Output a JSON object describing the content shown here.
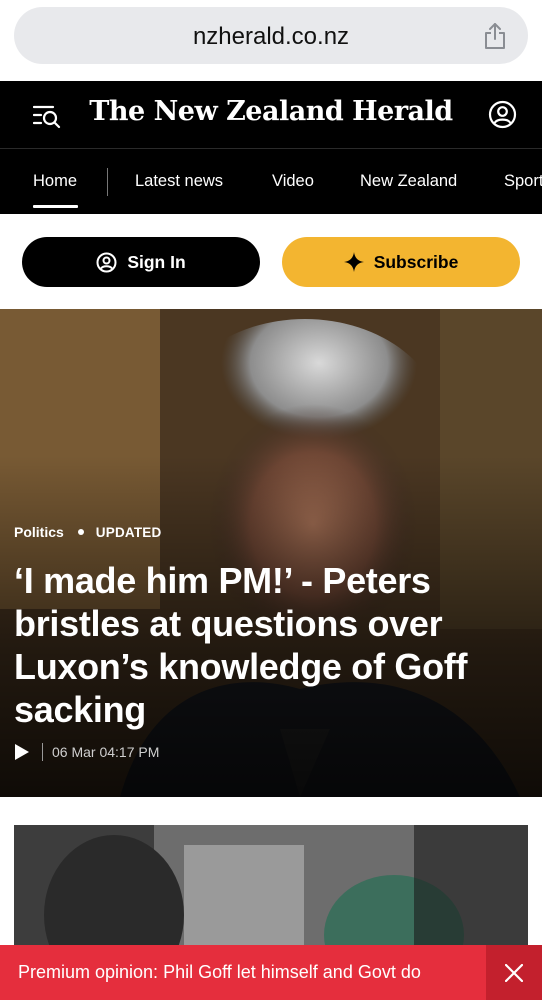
{
  "browser": {
    "url": "nzherald.co.nz",
    "share_icon": "share-icon"
  },
  "header": {
    "masthead": "The New Zealand Herald",
    "menu_icon": "menu-search-icon",
    "account_icon": "account-icon"
  },
  "nav": {
    "items": [
      "Home",
      "Latest news",
      "Video",
      "New Zealand",
      "Sport"
    ],
    "active": "Home"
  },
  "auth": {
    "sign_in_label": "Sign In",
    "subscribe_label": "Subscribe",
    "subscribe_color": "#f3b530"
  },
  "hero": {
    "category": "Politics",
    "status": "UPDATED",
    "headline": "‘I made him PM!’ - Peters bristles at questions over Luxon’s knowledge of Goff sacking",
    "timestamp": "06 Mar 04:17 PM"
  },
  "banner": {
    "text": "Premium opinion: Phil Goff let himself and Govt do",
    "color": "#e52e3d"
  }
}
